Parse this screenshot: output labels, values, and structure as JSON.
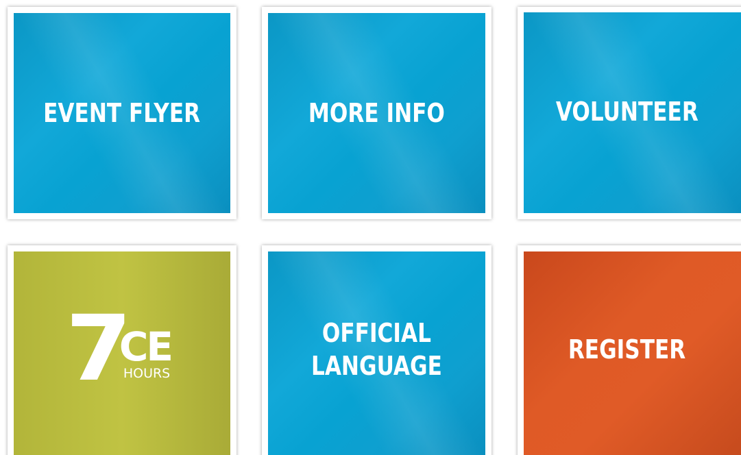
{
  "tiles": {
    "event_flyer": {
      "label": "EVENT FLYER",
      "color": "#0fa1d1"
    },
    "more_info": {
      "label": "MORE INFO",
      "color": "#0fa1d1"
    },
    "volunteer": {
      "label": "VOLUNTEER",
      "color": "#0fa1d1"
    },
    "ce_hours": {
      "number": "7",
      "letters": "CE",
      "sub": "HOURS",
      "color": "#b6b93d"
    },
    "official_language": {
      "line1": "OFFICIAL",
      "line2": "LANGUAGE",
      "color": "#0fa1d1"
    },
    "register": {
      "label": "REGISTER",
      "color": "#da5424"
    }
  }
}
